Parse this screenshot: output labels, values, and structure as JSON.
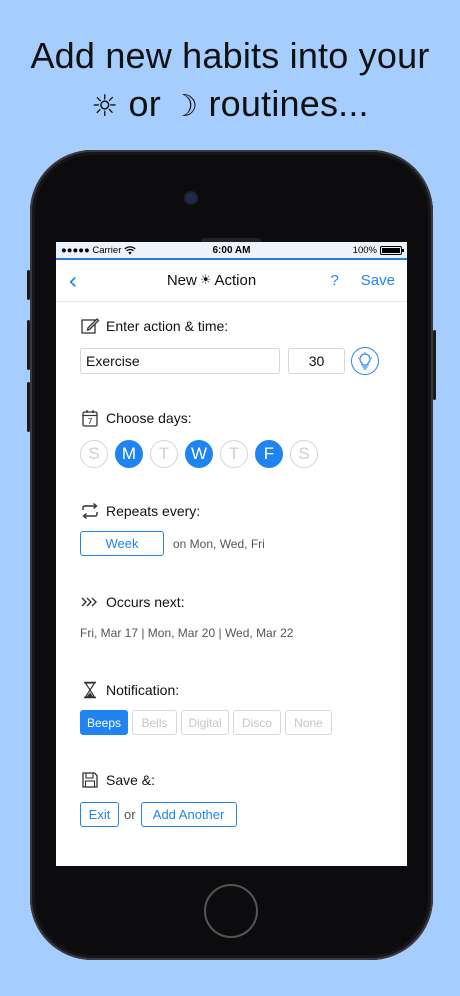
{
  "headline": {
    "line1": "Add new habits into your",
    "sun_symbol": "☼",
    "line2_mid": "or",
    "moon_symbol": "☽",
    "line2_end": "routines..."
  },
  "statusbar": {
    "carrier": "●●●●● Carrier",
    "time": "6:00 AM",
    "battery": "100%"
  },
  "nav": {
    "back": "‹",
    "title_prefix": "New",
    "title_symbol": "☀",
    "title_suffix": "Action",
    "help": "?",
    "save": "Save"
  },
  "action": {
    "heading": "Enter action & time:",
    "name_value": "Exercise",
    "minutes_value": "30",
    "icon": "pencil-icon"
  },
  "days": {
    "heading": "Choose days:",
    "items": [
      {
        "label": "S",
        "selected": false
      },
      {
        "label": "M",
        "selected": true
      },
      {
        "label": "T",
        "selected": false
      },
      {
        "label": "W",
        "selected": true
      },
      {
        "label": "T",
        "selected": false
      },
      {
        "label": "F",
        "selected": true
      },
      {
        "label": "S",
        "selected": false
      }
    ]
  },
  "repeats": {
    "heading": "Repeats every:",
    "unit": "Week",
    "summary": "on Mon, Wed, Fri"
  },
  "occurs": {
    "heading": "Occurs next:",
    "dates": "Fri, Mar 17 | Mon, Mar 20 | Wed, Mar 22"
  },
  "notification": {
    "heading": "Notification:",
    "options": [
      {
        "label": "Beeps",
        "selected": true
      },
      {
        "label": "Bells",
        "selected": false
      },
      {
        "label": "Digital",
        "selected": false
      },
      {
        "label": "Disco",
        "selected": false
      },
      {
        "label": "None",
        "selected": false
      }
    ]
  },
  "save": {
    "heading": "Save &:",
    "exit": "Exit",
    "or": "or",
    "add_another": "Add Another"
  },
  "colors": {
    "background": "#a5cdfd",
    "accent": "#1f84f0"
  }
}
